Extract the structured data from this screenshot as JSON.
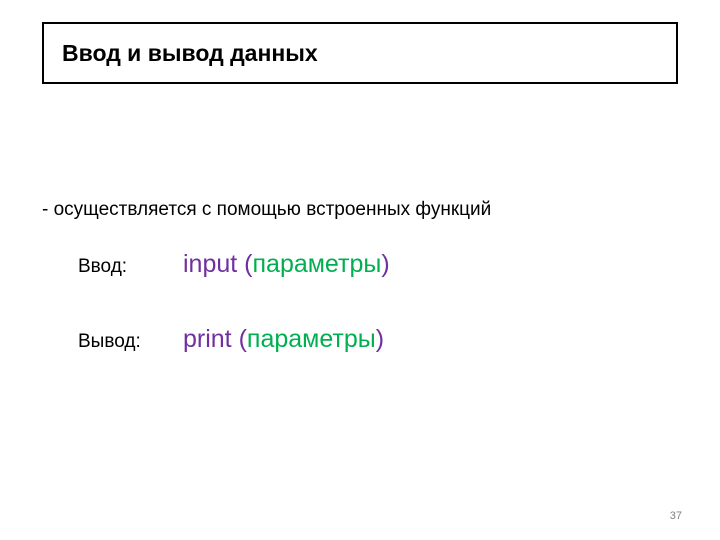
{
  "title": "Ввод и вывод данных",
  "description": "- осуществляется с помощью встроенных функций",
  "input": {
    "label": "Ввод:",
    "func": "input",
    "open": " (",
    "param": "параметры",
    "close": ")"
  },
  "output": {
    "label": "Вывод:",
    "func": "print",
    "open": " (",
    "param": "параметры",
    "close": ")"
  },
  "page_number": "37"
}
